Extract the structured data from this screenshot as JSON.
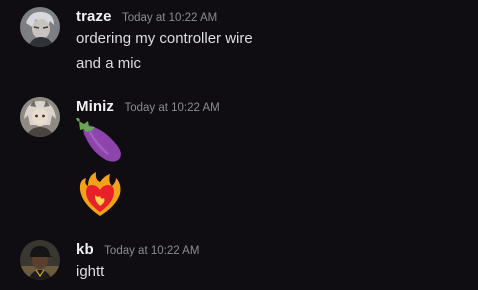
{
  "messages": [
    {
      "username": "traze",
      "timestamp": "Today at 10:22 AM",
      "avatar_icon": "grey-anime-character-avatar",
      "lines": [
        "ordering my controller wire",
        "and a mic"
      ]
    },
    {
      "username": "Miniz",
      "timestamp": "Today at 10:22 AM",
      "avatar_icon": "anime-girl-avatar",
      "emojis": [
        "eggplant-emoji",
        "heart-on-fire-emoji"
      ]
    },
    {
      "username": "kb",
      "timestamp": "Today at 10:22 AM",
      "avatar_icon": "person-in-cap-avatar",
      "lines": [
        "ightt"
      ]
    }
  ],
  "colors": {
    "background": "#0f0c12",
    "username": "#f2f3f5",
    "timestamp": "#8a8d93",
    "message_text": "#dcdde1"
  }
}
